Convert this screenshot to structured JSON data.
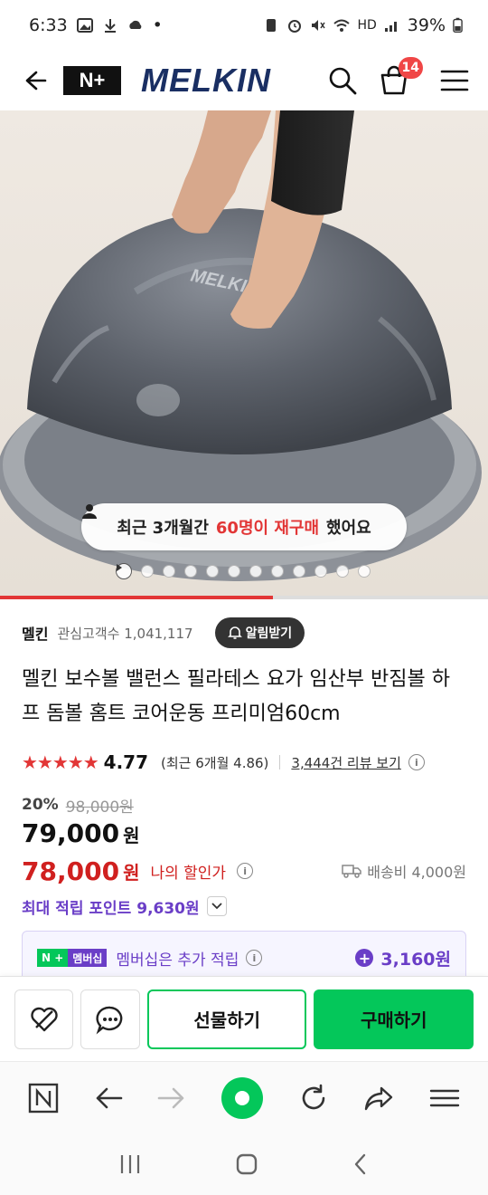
{
  "status_bar": {
    "time": "6:33",
    "dot": "•",
    "hd_label": "HD",
    "battery": "39%"
  },
  "nav": {
    "brand_logo": "MELKIN",
    "partner_logo": "N+",
    "cart_count": "14"
  },
  "hero": {
    "product_mark": "MELKIN",
    "repurchase_prefix": "최근 3개월간",
    "repurchase_highlight": "60명이 재구매",
    "repurchase_suffix": "했어요",
    "dot_count": 12,
    "video_progress": 0.56
  },
  "seller": {
    "name": "멜킨",
    "followers_label": "관심고객수 1,041,117",
    "notify_label": "알림받기"
  },
  "product": {
    "title": "멜킨 보수볼 밸런스 필라테스 요가 임산부 반짐볼 하프 돔볼 홈트 코어운동 프리미엄60cm"
  },
  "rating": {
    "stars": "★★★★★",
    "score": "4.77",
    "recent": "(최근 6개월 4.86)",
    "review_link": "3,444건 리뷰 보기"
  },
  "pricing": {
    "discount_pct": "20%",
    "original_price": "98,000원",
    "price": "79,000",
    "price_won": "원",
    "my_price": "78,000",
    "my_price_won": "원",
    "my_price_label": "나의 할인가",
    "shipping": "배송비 4,000원",
    "points_label": "최대 적립 포인트 9,630원"
  },
  "membership": {
    "badge_n": "N +",
    "badge_m": "멤버십",
    "text": "멤버십은 추가 적립",
    "amount": "3,160원"
  },
  "actions": {
    "gift": "선물하기",
    "buy": "구매하기"
  },
  "colors": {
    "naver_green": "#04c75a",
    "sale_red": "#d0201f",
    "points_purple": "#6a3ec7",
    "brand_navy": "#1a2f63"
  },
  "icons": [
    "back-arrow-icon",
    "search-icon",
    "cart-icon",
    "menu-icon",
    "person-icon",
    "bell-plus-icon",
    "info-icon",
    "truck-icon",
    "chevron-down-icon",
    "wishlist-icon",
    "chat-icon",
    "n-home-icon",
    "browser-back-icon",
    "browser-forward-icon",
    "browser-home-icon",
    "refresh-icon",
    "share-icon",
    "browser-menu-icon",
    "recents-icon",
    "system-home-icon",
    "system-back-icon"
  ]
}
